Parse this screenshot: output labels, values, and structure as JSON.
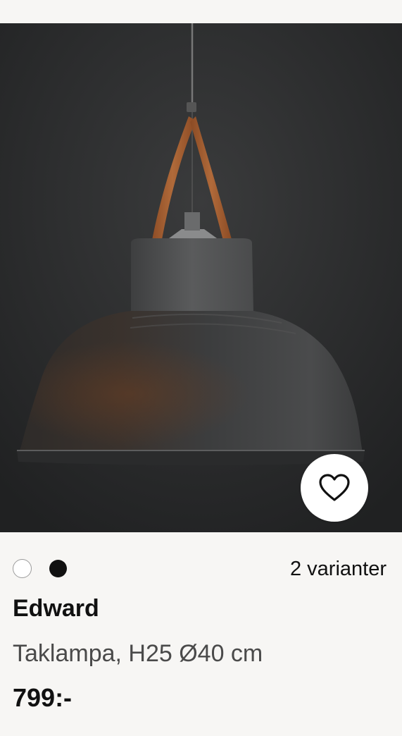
{
  "product": {
    "image_subject": "pendant-lamp-photo",
    "favorite_icon": "heart-icon",
    "variants": {
      "swatches": [
        {
          "name": "white",
          "color": "#ffffff"
        },
        {
          "name": "black",
          "color": "#111111"
        }
      ],
      "count_label": "2 varianter"
    },
    "name": "Edward",
    "description": "Taklampa, H25 Ø40 cm",
    "price": "799:-"
  }
}
